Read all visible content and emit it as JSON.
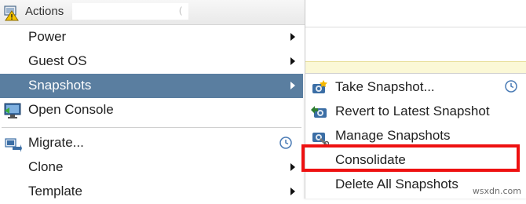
{
  "header": {
    "title": "Actions",
    "icon": "vm-warning-icon"
  },
  "menu": {
    "items": [
      {
        "label": "Power",
        "submenu": true
      },
      {
        "label": "Guest OS",
        "submenu": true
      },
      {
        "label": "Snapshots",
        "submenu": true,
        "active": true
      },
      {
        "label": "Open Console",
        "icon": "console-icon"
      },
      {
        "label": "Migrate...",
        "icon": "migrate-icon",
        "clock": true
      },
      {
        "label": "Clone",
        "submenu": true
      },
      {
        "label": "Template",
        "submenu": true
      }
    ]
  },
  "submenu": {
    "items": [
      {
        "label": "Take Snapshot...",
        "icon": "take-snapshot-icon",
        "clock": true
      },
      {
        "label": "Revert to Latest Snapshot",
        "icon": "revert-snapshot-icon"
      },
      {
        "label": "Manage Snapshots",
        "icon": "manage-snapshots-icon"
      },
      {
        "label": "Consolidate",
        "highlighted": true
      },
      {
        "label": "Delete All Snapshots"
      }
    ]
  },
  "colors": {
    "active": "#5a7ea0",
    "highlight_border": "#ee1111"
  },
  "watermark": "wsxdn.com"
}
